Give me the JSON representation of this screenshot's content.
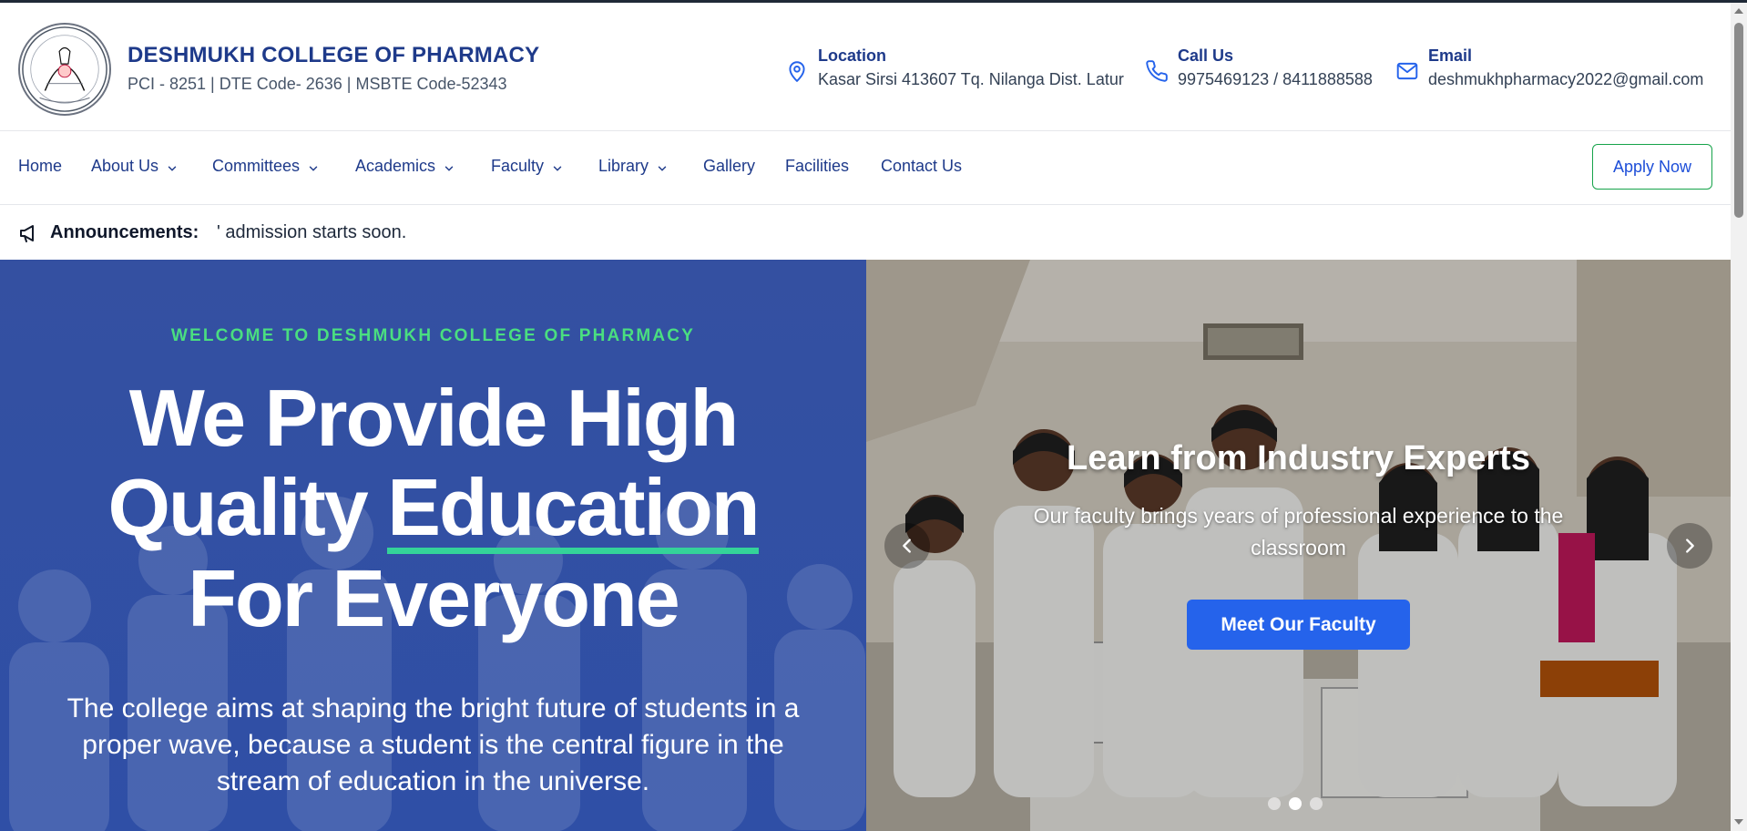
{
  "header": {
    "college_name": "DESHMUKH COLLEGE OF PHARMACY",
    "codes": "PCI - 8251 | DTE Code- 2636 | MSBTE Code-52343",
    "location": {
      "label": "Location",
      "value": "Kasar Sirsi 413607 Tq. Nilanga Dist. Latur",
      "icon": "map-pin-icon"
    },
    "call": {
      "label": "Call Us",
      "value": "9975469123 / 8411888588",
      "icon": "phone-icon"
    },
    "email": {
      "label": "Email",
      "value": "deshmukhpharmacy2022@gmail.com",
      "icon": "mail-icon"
    }
  },
  "nav": {
    "items": [
      {
        "label": "Home",
        "dropdown": false
      },
      {
        "label": "About Us",
        "dropdown": true
      },
      {
        "label": "Committees",
        "dropdown": true
      },
      {
        "label": "Academics",
        "dropdown": true
      },
      {
        "label": "Faculty",
        "dropdown": true
      },
      {
        "label": "Library",
        "dropdown": true
      },
      {
        "label": "Gallery",
        "dropdown": false
      },
      {
        "label": "Facilities",
        "dropdown": false
      },
      {
        "label": "Contact Us",
        "dropdown": false
      }
    ],
    "apply_label": "Apply Now"
  },
  "announcement": {
    "label": "Announcements:",
    "text": "' admission starts soon."
  },
  "hero": {
    "welcome": "WELCOME TO DESHMUKH COLLEGE OF PHARMACY",
    "headline_line1": "We Provide High",
    "headline_line2_pre": "Quality ",
    "headline_highlight": "Education",
    "headline_line3": "For Everyone",
    "description": "The college aims at shaping the bright future of students in a proper wave, because a student is the central figure in the stream of education in the universe."
  },
  "slider": {
    "title": "Learn from Industry Experts",
    "subtitle": "Our faculty brings years of professional experience to the classroom",
    "button": "Meet Our Faculty",
    "slide_count": 3,
    "active_slide": 2
  },
  "colors": {
    "brand_navy": "#1e3a8a",
    "accent_green": "#4ade80",
    "underline_green": "#34d399",
    "hero_blue": "#3450a1",
    "button_blue": "#2563eb"
  }
}
